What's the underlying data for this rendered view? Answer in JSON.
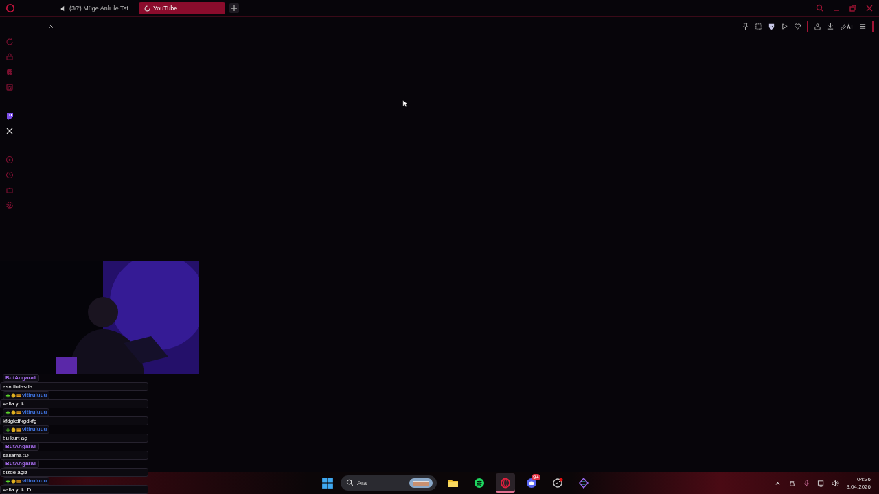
{
  "tabs": [
    {
      "label": "(36') Müge Anlı ile Tat",
      "selected": false,
      "audio": true
    },
    {
      "label": "YouTube",
      "selected": true,
      "audio": false
    }
  ],
  "chat": [
    {
      "user": "ButAngarali",
      "color": "#a46be8",
      "badges": false,
      "text": "asvdbdasda"
    },
    {
      "user": "vitiruluuu",
      "color": "#3d6fd6",
      "badges": true,
      "text": "valla yok"
    },
    {
      "user": "vitiruluuu",
      "color": "#3d6fd6",
      "badges": true,
      "text": "kfdgkdfkgdkfg"
    },
    {
      "user": "vitiruluuu",
      "color": "#3d6fd6",
      "badges": true,
      "text": "bu kurt aç"
    },
    {
      "user": "ButAngarali",
      "color": "#a46be8",
      "badges": false,
      "text": "sallama :D"
    },
    {
      "user": "ButAngarali",
      "color": "#a46be8",
      "badges": false,
      "text": "bizde açız"
    },
    {
      "user": "vitiruluuu",
      "color": "#3d6fd6",
      "badges": true,
      "text": "valla yok :D"
    }
  ],
  "taskbar": {
    "search_placeholder": "Ara",
    "apps": [
      {
        "kind": "folder",
        "selected": false
      },
      {
        "kind": "spotify",
        "selected": false
      },
      {
        "kind": "opera",
        "selected": true
      },
      {
        "kind": "discord",
        "selected": false,
        "badge": "9+"
      },
      {
        "kind": "steam",
        "selected": false
      },
      {
        "kind": "diamond",
        "selected": false
      }
    ]
  },
  "clock": {
    "time": "04:36",
    "date": "3.04.2026"
  }
}
